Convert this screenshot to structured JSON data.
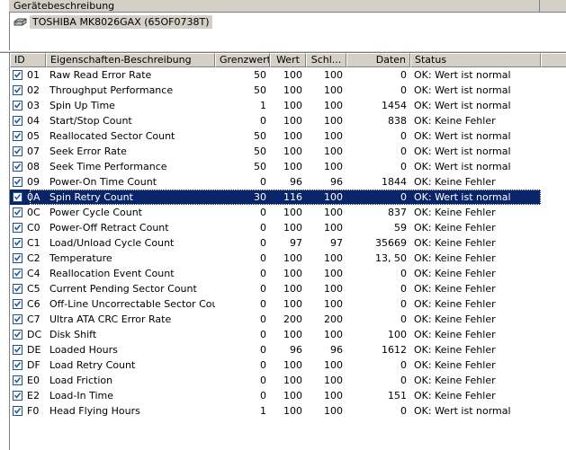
{
  "device_section": {
    "title": "Gerätebeschreibung",
    "device_name": "TOSHIBA MK8026GAX (65OF0738T)"
  },
  "table": {
    "columns": [
      "ID",
      "Eigenschaften-Beschreibung",
      "Grenzwert",
      "Wert",
      "Schl...",
      "Daten",
      "Status"
    ],
    "rows": [
      {
        "id": "01",
        "desc": "Raw Read Error Rate",
        "grenz": "50",
        "wert": "100",
        "schl": "100",
        "daten": "0",
        "status": "OK: Wert ist normal"
      },
      {
        "id": "02",
        "desc": "Throughput Performance",
        "grenz": "50",
        "wert": "100",
        "schl": "100",
        "daten": "0",
        "status": "OK: Wert ist normal"
      },
      {
        "id": "03",
        "desc": "Spin Up Time",
        "grenz": "1",
        "wert": "100",
        "schl": "100",
        "daten": "1454",
        "status": "OK: Wert ist normal"
      },
      {
        "id": "04",
        "desc": "Start/Stop Count",
        "grenz": "0",
        "wert": "100",
        "schl": "100",
        "daten": "838",
        "status": "OK: Keine Fehler"
      },
      {
        "id": "05",
        "desc": "Reallocated Sector Count",
        "grenz": "50",
        "wert": "100",
        "schl": "100",
        "daten": "0",
        "status": "OK: Wert ist normal"
      },
      {
        "id": "07",
        "desc": "Seek Error Rate",
        "grenz": "50",
        "wert": "100",
        "schl": "100",
        "daten": "0",
        "status": "OK: Wert ist normal"
      },
      {
        "id": "08",
        "desc": "Seek Time Performance",
        "grenz": "50",
        "wert": "100",
        "schl": "100",
        "daten": "0",
        "status": "OK: Wert ist normal"
      },
      {
        "id": "09",
        "desc": "Power-On Time Count",
        "grenz": "0",
        "wert": "96",
        "schl": "96",
        "daten": "1844",
        "status": "OK: Keine Fehler"
      },
      {
        "id": "0A",
        "desc": "Spin Retry Count",
        "grenz": "30",
        "wert": "116",
        "schl": "100",
        "daten": "0",
        "status": "OK: Wert ist normal"
      },
      {
        "id": "0C",
        "desc": "Power Cycle Count",
        "grenz": "0",
        "wert": "100",
        "schl": "100",
        "daten": "837",
        "status": "OK: Keine Fehler"
      },
      {
        "id": "C0",
        "desc": "Power-Off Retract Count",
        "grenz": "0",
        "wert": "100",
        "schl": "100",
        "daten": "59",
        "status": "OK: Keine Fehler"
      },
      {
        "id": "C1",
        "desc": "Load/Unload Cycle Count",
        "grenz": "0",
        "wert": "97",
        "schl": "97",
        "daten": "35669",
        "status": "OK: Keine Fehler"
      },
      {
        "id": "C2",
        "desc": "Temperature",
        "grenz": "0",
        "wert": "100",
        "schl": "100",
        "daten": "13, 50",
        "status": "OK: Keine Fehler"
      },
      {
        "id": "C4",
        "desc": "Reallocation Event Count",
        "grenz": "0",
        "wert": "100",
        "schl": "100",
        "daten": "0",
        "status": "OK: Keine Fehler"
      },
      {
        "id": "C5",
        "desc": "Current Pending Sector Count",
        "grenz": "0",
        "wert": "100",
        "schl": "100",
        "daten": "0",
        "status": "OK: Keine Fehler"
      },
      {
        "id": "C6",
        "desc": "Off-Line Uncorrectable Sector Count",
        "grenz": "0",
        "wert": "100",
        "schl": "100",
        "daten": "0",
        "status": "OK: Keine Fehler"
      },
      {
        "id": "C7",
        "desc": "Ultra ATA CRC Error Rate",
        "grenz": "0",
        "wert": "200",
        "schl": "200",
        "daten": "0",
        "status": "OK: Keine Fehler"
      },
      {
        "id": "DC",
        "desc": "Disk Shift",
        "grenz": "0",
        "wert": "100",
        "schl": "100",
        "daten": "100",
        "status": "OK: Keine Fehler"
      },
      {
        "id": "DE",
        "desc": "Loaded Hours",
        "grenz": "0",
        "wert": "96",
        "schl": "96",
        "daten": "1612",
        "status": "OK: Keine Fehler"
      },
      {
        "id": "DF",
        "desc": "Load Retry Count",
        "grenz": "0",
        "wert": "100",
        "schl": "100",
        "daten": "0",
        "status": "OK: Keine Fehler"
      },
      {
        "id": "E0",
        "desc": "Load Friction",
        "grenz": "0",
        "wert": "100",
        "schl": "100",
        "daten": "0",
        "status": "OK: Keine Fehler"
      },
      {
        "id": "E2",
        "desc": "Load-In Time",
        "grenz": "0",
        "wert": "100",
        "schl": "100",
        "daten": "151",
        "status": "OK: Keine Fehler"
      },
      {
        "id": "F0",
        "desc": "Head Flying Hours",
        "grenz": "1",
        "wert": "100",
        "schl": "100",
        "daten": "0",
        "status": "OK: Wert ist normal"
      }
    ],
    "selected_index": 8
  },
  "icons": {
    "drive": "hard-drive-icon",
    "checkbox": "checkbox-checked-icon"
  },
  "colors": {
    "selection": "#0a246a",
    "face": "#d4d0c8"
  }
}
